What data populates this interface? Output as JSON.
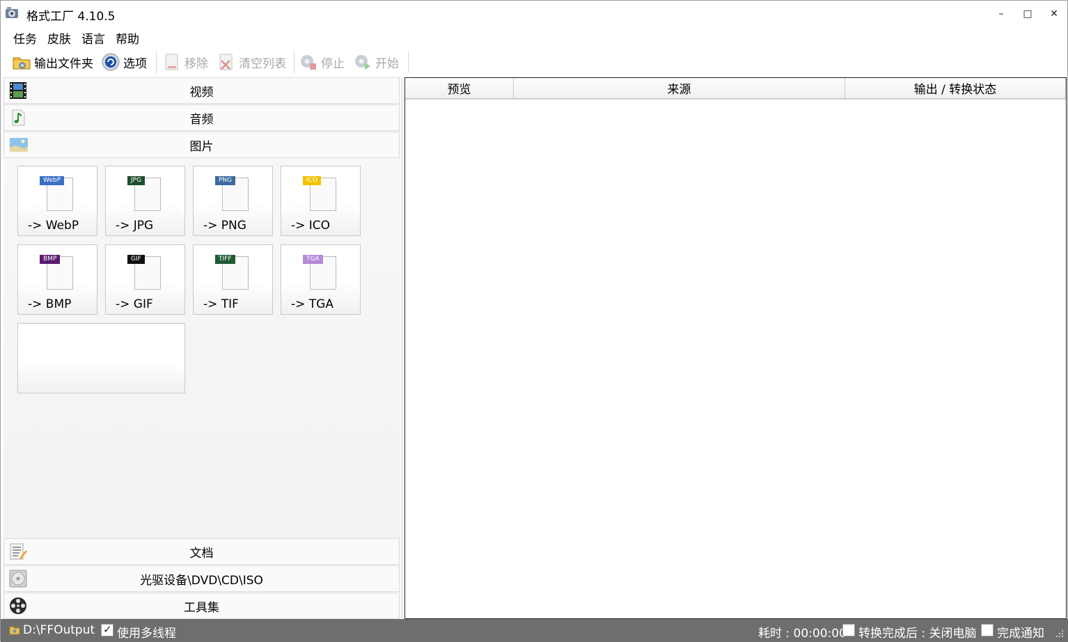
{
  "window": {
    "title": "格式工厂 4.10.5",
    "minimize": "–",
    "maximize": "□",
    "close": "✕"
  },
  "menu": [
    "任务",
    "皮肤",
    "语言",
    "帮助"
  ],
  "toolbar": {
    "output_folder": "输出文件夹",
    "options": "选项",
    "remove": "移除",
    "clear_list": "清空列表",
    "stop": "停止",
    "start": "开始"
  },
  "categories": {
    "video": "视频",
    "audio": "音频",
    "image": "图片",
    "document": "文档",
    "optical": "光驱设备\\DVD\\CD\\ISO",
    "tools": "工具集"
  },
  "image_formats": [
    {
      "label": "-> WebP",
      "tag": "WebP",
      "icon": "webp-file-icon",
      "color": "#3b6fc4"
    },
    {
      "label": "-> JPG",
      "tag": "JPG",
      "icon": "jpg-file-icon",
      "color": "#1d4f2e"
    },
    {
      "label": "-> PNG",
      "tag": "PNG",
      "icon": "png-file-icon",
      "color": "#3c6a9e"
    },
    {
      "label": "-> ICO",
      "tag": "ICO",
      "icon": "ico-file-icon",
      "color": "#f2c200"
    },
    {
      "label": "-> BMP",
      "tag": "BMP",
      "icon": "bmp-file-icon",
      "color": "#5a1a6e"
    },
    {
      "label": "-> GIF",
      "tag": "GIF",
      "icon": "gif-file-icon",
      "color": "#111111"
    },
    {
      "label": "-> TIF",
      "tag": "TIFF",
      "icon": "tiff-file-icon",
      "color": "#1f5a33"
    },
    {
      "label": "-> TGA",
      "tag": "TGA",
      "icon": "tga-file-icon",
      "color": "#b48ad8"
    }
  ],
  "task_list": {
    "columns": [
      "预览",
      "来源",
      "输出 / 转换状态"
    ]
  },
  "status": {
    "output_path": "D:\\FFOutput",
    "multithread_label": "使用多线程",
    "multithread_checked": true,
    "elapsed": "耗时 : 00:00:00",
    "shutdown_label": "转换完成后 : 关闭电脑",
    "shutdown_checked": false,
    "notify_label": "完成通知",
    "notify_checked": false
  }
}
